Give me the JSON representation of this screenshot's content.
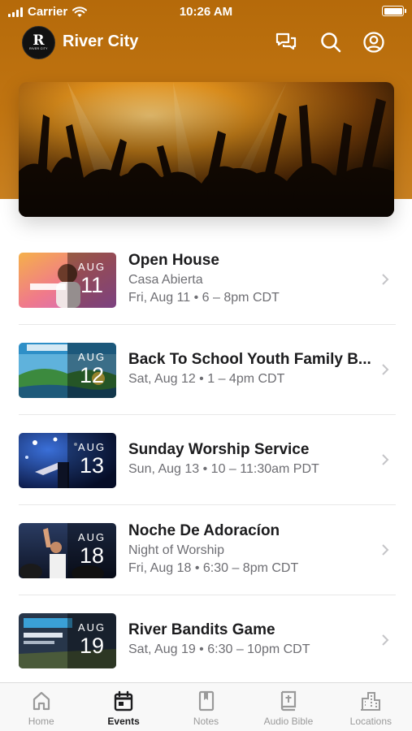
{
  "status_bar": {
    "carrier": "Carrier",
    "time": "10:26 AM"
  },
  "header": {
    "app_name": "River City",
    "logo_text": "RIVER CITY",
    "logo_letter": "R"
  },
  "events": [
    {
      "month": "AUG",
      "day": "11",
      "title": "Open House",
      "subtitle": "Casa Abierta",
      "when": "Fri, Aug 11 • 6 – 8pm CDT"
    },
    {
      "month": "AUG",
      "day": "12",
      "title": "Back To School Youth Family B...",
      "subtitle": "",
      "when": "Sat, Aug 12 • 1 – 4pm CDT"
    },
    {
      "month": "AUG",
      "day": "13",
      "title": "Sunday Worship Service",
      "subtitle": "",
      "when": "Sun, Aug 13 • 10 – 11:30am PDT"
    },
    {
      "month": "AUG",
      "day": "18",
      "title": "Noche De Adoracíon",
      "subtitle": "Night of Worship",
      "when": "Fri, Aug 18 • 6:30 – 8pm CDT"
    },
    {
      "month": "AUG",
      "day": "19",
      "title": "River Bandits Game",
      "subtitle": "",
      "when": "Sat, Aug 19 • 6:30 – 10pm CDT"
    }
  ],
  "tabs": [
    {
      "label": "Home",
      "icon": "home-icon",
      "active": false
    },
    {
      "label": "Events",
      "icon": "calendar-icon",
      "active": true
    },
    {
      "label": "Notes",
      "icon": "notes-icon",
      "active": false
    },
    {
      "label": "Audio Bible",
      "icon": "bible-icon",
      "active": false
    },
    {
      "label": "Locations",
      "icon": "building-icon",
      "active": false
    }
  ],
  "colors": {
    "header_orange": "#c07411",
    "active_tab": "#1c1c1e",
    "inactive_tab": "#9a9a9a"
  }
}
